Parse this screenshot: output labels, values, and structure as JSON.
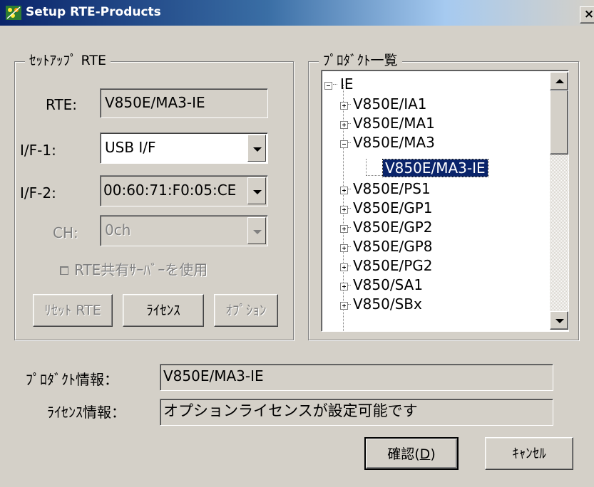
{
  "window": {
    "title": "Setup RTE-Products",
    "close_label": "×"
  },
  "rte_group": {
    "label": "ｾｯﾄｱｯﾌﾟ RTE",
    "rte": {
      "label": "RTE:",
      "value": "V850E/MA3-IE"
    },
    "if1": {
      "label": "I/F-1:",
      "value": "USB I/F"
    },
    "if2": {
      "label": "I/F-2:",
      "value": "00:60:71:F0:05:CE"
    },
    "ch": {
      "label": "CH:",
      "value": "0ch"
    },
    "shared_server": {
      "label": "RTE共有ｻｰﾊﾞｰを使用",
      "checked": false
    },
    "buttons": {
      "reset": "ﾘｾｯﾄ RTE",
      "license": "ﾗｲｾﾝｽ",
      "option": "ｵﾌﾟｼｮﾝ"
    }
  },
  "product_group": {
    "label": "ﾌﾟﾛﾀﾞｸﾄ一覧",
    "tree": {
      "root": "IE",
      "items": [
        {
          "label": "V850E/IA1",
          "expander": "+"
        },
        {
          "label": "V850E/MA1",
          "expander": "+"
        },
        {
          "label": "V850E/MA3",
          "expander": "-"
        },
        {
          "label": "V850E/MA3-IE",
          "selected": true
        },
        {
          "label": "V850E/PS1",
          "expander": "+"
        },
        {
          "label": "V850E/GP1",
          "expander": "+"
        },
        {
          "label": "V850E/GP2",
          "expander": "+"
        },
        {
          "label": "V850E/GP8",
          "expander": "+"
        },
        {
          "label": "V850E/PG2",
          "expander": "+"
        },
        {
          "label": "V850/SA1",
          "expander": "+"
        },
        {
          "label": "V850/SBx",
          "expander": "+"
        }
      ]
    }
  },
  "product_info": {
    "label": "ﾌﾟﾛﾀﾞｸﾄ情報：",
    "value": "V850E/MA3-IE"
  },
  "license_info": {
    "label": "ﾗｲｾﾝｽ情報：",
    "value": "オプションライセンスが設定可能です"
  },
  "buttons": {
    "ok": {
      "label": "確認(",
      "accel": "D",
      "suffix": ")"
    },
    "cancel": "ｷｬﾝｾﾙ"
  },
  "colors": {
    "face": "#d4d0c8",
    "title_start": "#0a246a",
    "selection": "#0a246a"
  }
}
